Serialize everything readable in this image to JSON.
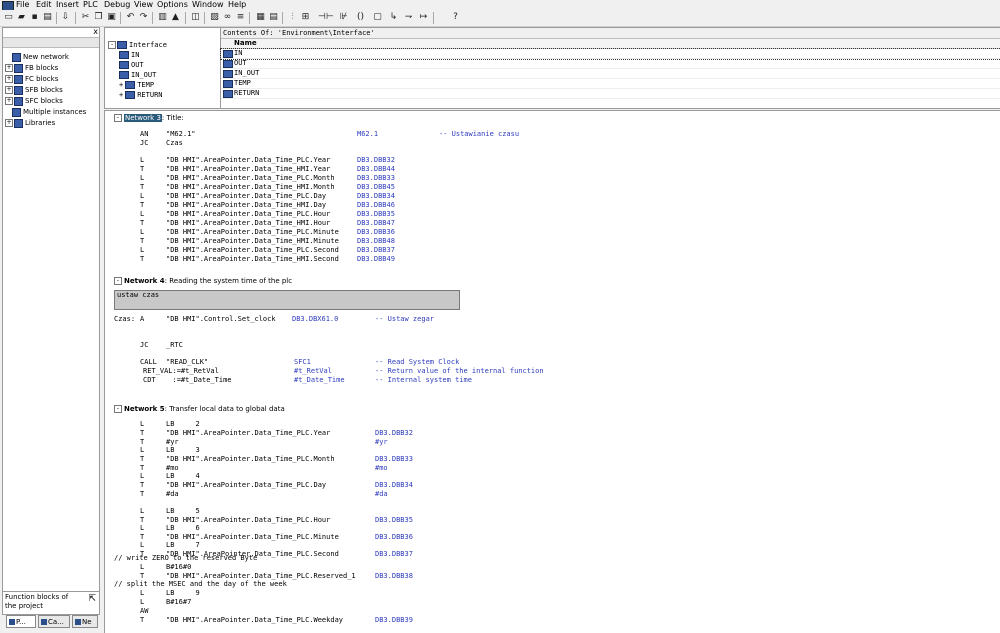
{
  "menu": [
    "File",
    "Edit",
    "Insert",
    "PLC",
    "Debug",
    "View",
    "Options",
    "Window",
    "Help"
  ],
  "left_pane": {
    "close_label": "x",
    "tree": [
      {
        "label": "New network",
        "expander": ""
      },
      {
        "label": "FB blocks",
        "expander": "+"
      },
      {
        "label": "FC blocks",
        "expander": "+"
      },
      {
        "label": "SFB blocks",
        "expander": "+"
      },
      {
        "label": "SFC blocks",
        "expander": "+"
      },
      {
        "label": "Multiple instances",
        "expander": ""
      },
      {
        "label": "Libraries",
        "expander": "+"
      }
    ],
    "status_text": "Function blocks of the project",
    "tabs": [
      "P...",
      "Ca...",
      "Ne"
    ]
  },
  "interface": {
    "root": "Interface",
    "root_expander": "-",
    "items": [
      {
        "label": "IN",
        "expander": ""
      },
      {
        "label": "OUT",
        "expander": ""
      },
      {
        "label": "IN_OUT",
        "expander": ""
      },
      {
        "label": "TEMP",
        "expander": "+"
      },
      {
        "label": "RETURN",
        "expander": "+"
      }
    ]
  },
  "contents": {
    "title": "Contents Of: 'Environment\\Interface'",
    "column_name": "Name",
    "rows": [
      "IN",
      "OUT",
      "IN_OUT",
      "TEMP",
      "RETURN"
    ]
  },
  "editor": {
    "network3": {
      "label": "Network 3",
      "expander": "-",
      "title": ": Title:"
    },
    "lines_a": [
      {
        "op": "AN",
        "arg": "\"M62.1\"",
        "addr": "M62.1",
        "cmt": "-- Ustawianie czasu"
      },
      {
        "op": "JC",
        "arg": "Czas",
        "addr": "",
        "cmt": ""
      },
      {
        "op": "L",
        "arg": "\"DB HMI\".AreaPointer.Data_Time_PLC.Year",
        "addr": "DB3.DBB32",
        "cmt": ""
      },
      {
        "op": "T",
        "arg": "\"DB HMI\".AreaPointer.Data_Time_HMI.Year",
        "addr": "DB3.DBB44",
        "cmt": ""
      },
      {
        "op": "L",
        "arg": "\"DB HMI\".AreaPointer.Data_Time_PLC.Month",
        "addr": "DB3.DBB33",
        "cmt": ""
      },
      {
        "op": "T",
        "arg": "\"DB HMI\".AreaPointer.Data_Time_HMI.Month",
        "addr": "DB3.DBB45",
        "cmt": ""
      },
      {
        "op": "L",
        "arg": "\"DB HMI\".AreaPointer.Data_Time_PLC.Day",
        "addr": "DB3.DBB34",
        "cmt": ""
      },
      {
        "op": "T",
        "arg": "\"DB HMI\".AreaPointer.Data_Time_HMI.Day",
        "addr": "DB3.DBB46",
        "cmt": ""
      },
      {
        "op": "L",
        "arg": "\"DB HMI\".AreaPointer.Data_Time_PLC.Hour",
        "addr": "DB3.DBB35",
        "cmt": ""
      },
      {
        "op": "T",
        "arg": "\"DB HMI\".AreaPointer.Data_Time_HMI.Hour",
        "addr": "DB3.DBB47",
        "cmt": ""
      },
      {
        "op": "L",
        "arg": "\"DB HMI\".AreaPointer.Data_Time_PLC.Minute",
        "addr": "DB3.DBB36",
        "cmt": ""
      },
      {
        "op": "T",
        "arg": "\"DB HMI\".AreaPointer.Data_Time_HMI.Minute",
        "addr": "DB3.DBB48",
        "cmt": ""
      },
      {
        "op": "L",
        "arg": "\"DB HMI\".AreaPointer.Data_Time_PLC.Second",
        "addr": "DB3.DBB37",
        "cmt": ""
      },
      {
        "op": "T",
        "arg": "\"DB HMI\".AreaPointer.Data_Time_HMI.Second",
        "addr": "DB3.DBB49",
        "cmt": ""
      }
    ],
    "network4": {
      "label": "Network 4",
      "expander": "-",
      "title": ": Reading the system time of the plc"
    },
    "comment_box": "ustaw czas",
    "czas_line": {
      "label": "Czas:",
      "op": "A",
      "arg": "\"DB HMI\".Control.Set_clock",
      "addr": "DB3.DBX61.0",
      "cmt": "-- Ustaw zegar"
    },
    "jc_rtc": {
      "op": "JC",
      "arg": "_RTC"
    },
    "call_line": {
      "op": "CALL",
      "arg": "\"READ_CLK\"",
      "addr": "SFC1",
      "cmt": "-- Read System Clock"
    },
    "retval_line": {
      "param": "RET_VAL:=#t_RetVal",
      "addr": "#t_RetVal",
      "cmt": "-- Return value of the internal function"
    },
    "cdt_line": {
      "param": "CDT    :=#t_Date_Time",
      "addr": "#t_Date_Time",
      "cmt": "-- Internal system time"
    },
    "network5": {
      "label": "Network 5",
      "expander": "-",
      "title": ": Transfer local data to global data"
    },
    "lines_b": [
      {
        "op": "L",
        "arg": "LB     2",
        "addr": ""
      },
      {
        "op": "T",
        "arg": "\"DB HMI\".AreaPointer.Data_Time_PLC.Year",
        "addr": "DB3.DBB32"
      },
      {
        "op": "T",
        "arg": "#yr",
        "addr": "#yr"
      },
      {
        "op": "L",
        "arg": "LB     3",
        "addr": ""
      },
      {
        "op": "T",
        "arg": "\"DB HMI\".AreaPointer.Data_Time_PLC.Month",
        "addr": "DB3.DBB33"
      },
      {
        "op": "T",
        "arg": "#mo",
        "addr": "#mo"
      },
      {
        "op": "L",
        "arg": "LB     4",
        "addr": ""
      },
      {
        "op": "T",
        "arg": "\"DB HMI\".AreaPointer.Data_Time_PLC.Day",
        "addr": "DB3.DBB34"
      },
      {
        "op": "T",
        "arg": "#da",
        "addr": "#da"
      }
    ],
    "lines_c": [
      {
        "op": "L",
        "arg": "LB     5",
        "addr": ""
      },
      {
        "op": "T",
        "arg": "\"DB HMI\".AreaPointer.Data_Time_PLC.Hour",
        "addr": "DB3.DBB35"
      },
      {
        "op": "L",
        "arg": "LB     6",
        "addr": ""
      },
      {
        "op": "T",
        "arg": "\"DB HMI\".AreaPointer.Data_Time_PLC.Minute",
        "addr": "DB3.DBB36"
      },
      {
        "op": "L",
        "arg": "LB     7",
        "addr": ""
      },
      {
        "op": "T",
        "arg": "\"DB HMI\".AreaPointer.Data_Time_PLC.Second",
        "addr": "DB3.DBB37"
      }
    ],
    "comment_zero": "// write ZERO to the reserved Byte",
    "lines_d": [
      {
        "op": "L",
        "arg": "B#16#0",
        "addr": ""
      },
      {
        "op": "T",
        "arg": "\"DB HMI\".AreaPointer.Data_Time_PLC.Reserved_1",
        "addr": "DB3.DBB38"
      }
    ],
    "comment_split": "// split the MSEC and the day of the week",
    "lines_e": [
      {
        "op": "L",
        "arg": "LB     9",
        "addr": ""
      },
      {
        "op": "L",
        "arg": "B#16#7",
        "addr": ""
      },
      {
        "op": "AW",
        "arg": "",
        "addr": ""
      },
      {
        "op": "T",
        "arg": "\"DB HMI\".AreaPointer.Data_Time_PLC.Weekday",
        "addr": "DB3.DBB39"
      }
    ]
  }
}
